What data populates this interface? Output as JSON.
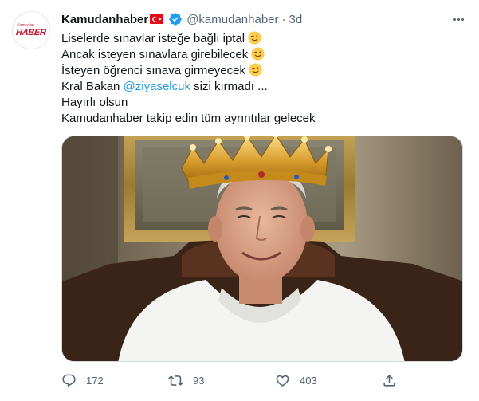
{
  "tweet": {
    "author": {
      "name": "Kamudanhaber",
      "handle": "@kamudanhaber",
      "timestamp": "3d",
      "separator": "·",
      "avatar_logo_small": "Kamudan",
      "avatar_logo_main": "HABER"
    },
    "lines": [
      "Liselerde sınavlar isteğe bağlı iptal",
      "Ancak isteyen sınavlara girebilecek",
      "İsteyen öğrenci sınava girmeyecek",
      "Kral Bakan ",
      "Hayırlı olsun",
      "Kamudanhaber takip edin tüm ayrıntılar gelecek"
    ],
    "mention": "@ziyaselcuk",
    "after_mention": " sizi kırmadı ...",
    "actions": {
      "reply_count": "172",
      "retweet_count": "93",
      "like_count": "403"
    }
  },
  "colors": {
    "link": "#1d9bf0",
    "secondary_text": "#536471",
    "brand_red": "#c8102e",
    "flag_red": "#e30a17"
  },
  "icons": [
    "wink-emoji-icon",
    "turkey-flag-icon",
    "verified-badge-icon",
    "more-icon",
    "reply-icon",
    "retweet-icon",
    "like-icon",
    "share-icon"
  ]
}
